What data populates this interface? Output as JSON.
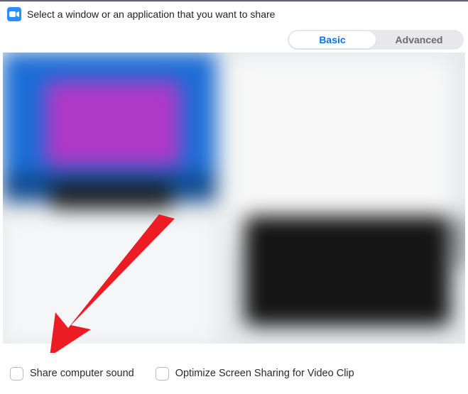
{
  "header": {
    "title": "Select a window or an application that you want to share"
  },
  "tabs": {
    "basic": "Basic",
    "advanced": "Advanced"
  },
  "footer": {
    "share_sound": "Share computer sound",
    "optimize_video": "Optimize Screen Sharing for Video Clip"
  },
  "colors": {
    "accent": "#0e71eb",
    "arrow": "#ed1c24"
  }
}
